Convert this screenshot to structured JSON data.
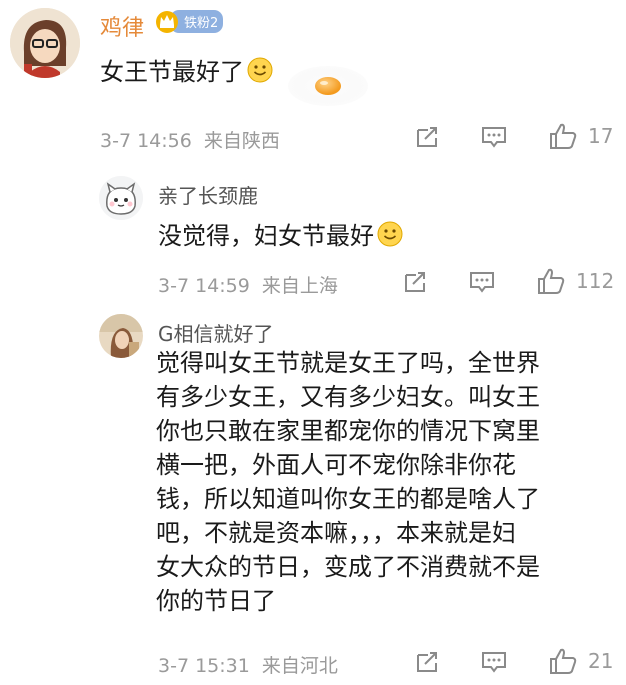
{
  "comment_main": {
    "author": "鸡律",
    "badge": "铁粉2",
    "text": "女王节最好了",
    "time": "3-7 14:56",
    "location": "来自陕西",
    "likes": "17"
  },
  "reply_1": {
    "author": "亲了长颈鹿",
    "text": "没觉得，妇女节最好",
    "time": "3-7 14:59",
    "location": "来自上海",
    "likes": "112"
  },
  "reply_2": {
    "author": "G相信就好了",
    "lines": [
      "觉得叫女王节就是女王了吗，全世界",
      "有多少女王，又有多少妇女。叫女王",
      "你也只敢在家里都宠你的情况下窝里",
      "横一把，外面人可不宠你除非你花",
      "钱，所以知道叫你女王的都是啥人了",
      "吧，不就是资本嘛，，，本来就是妇",
      "女大众的节日，变成了不消费就不是",
      "你的节日了"
    ],
    "time": "3-7 15:31",
    "location": "来自河北",
    "likes": "21"
  },
  "colors": {
    "name": "#e58a3a",
    "meta": "#9a9a9a",
    "badge": "#8eb0e0",
    "divider": "#eeeeee"
  }
}
